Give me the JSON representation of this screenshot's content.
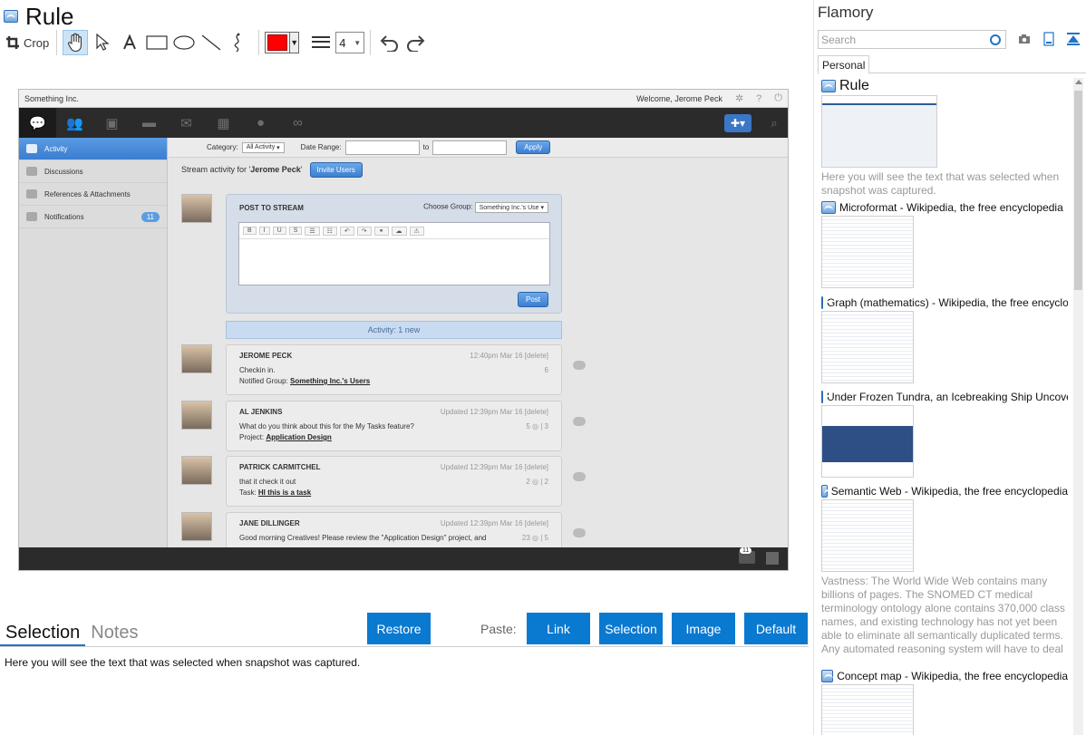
{
  "window": {
    "title": "Rule"
  },
  "toolbar": {
    "crop_label": "Crop",
    "line_width": "4",
    "color": "#ff0000",
    "tools": [
      "hand-icon",
      "pointer-icon",
      "text-icon",
      "rectangle-icon",
      "ellipse-icon",
      "line-icon",
      "freehand-icon"
    ]
  },
  "snapshot": {
    "company": "Something Inc.",
    "welcome": "Welcome, Jerome Peck",
    "sidebar": [
      {
        "label": "Activity"
      },
      {
        "label": "Discussions"
      },
      {
        "label": "References & Attachments"
      },
      {
        "label": "Notifications",
        "badge": "11"
      }
    ],
    "filter": {
      "category_label": "Category:",
      "category_value": "All Activity",
      "date_label": "Date Range:",
      "to_label": "to",
      "apply": "Apply"
    },
    "stream_prefix": "Stream activity for '",
    "stream_user": "Jerome Peck",
    "stream_suffix": "'",
    "invite": "Invite Users",
    "post": {
      "heading": "POST TO STREAM",
      "group_label": "Choose Group:",
      "group_value": "Something Inc.'s Use",
      "button": "Post",
      "tools": [
        "B",
        "I",
        "U",
        "S"
      ]
    },
    "activity_bar": "Activity: 1 new",
    "posts": [
      {
        "name": "JEROME PECK",
        "time": "12:40pm Mar 16 [delete]",
        "text": "Checkin in.",
        "meta_label": "Notified Group:",
        "meta_link": "Something Inc.'s Users",
        "counts": "6"
      },
      {
        "name": "AL JENKINS",
        "time": "Updated 12:39pm Mar 16 [delete]",
        "text": "What do you think about this for the My Tasks feature?",
        "meta_label": "Project:",
        "meta_link": "Application Design",
        "counts": "5 ◎ | 3"
      },
      {
        "name": "PATRICK CARMITCHEL",
        "time": "Updated 12:39pm Mar 16 [delete]",
        "text": "that it check it out",
        "meta_label": "Task:",
        "meta_link": "HI this is a task",
        "counts": "2 ◎ | 2"
      },
      {
        "name": "JANE DILLINGER",
        "time": "Updated 12:39pm Mar 16 [delete]",
        "text": "Good morning Creatives! Please review the \"Application Design\" project, and",
        "meta_label": "",
        "meta_link": "",
        "counts": "23 ◎ | 5"
      }
    ],
    "bottom_badge": "11"
  },
  "tabs": {
    "selection": "Selection",
    "notes": "Notes"
  },
  "buttons": {
    "restore": "Restore",
    "paste_label": "Paste:",
    "link": "Link",
    "selection": "Selection",
    "image": "Image",
    "default": "Default"
  },
  "selection_text": "Here you will see the text that was selected when snapshot was captured.",
  "panel": {
    "title": "Flamory",
    "search_placeholder": "Search",
    "tab": "Personal",
    "items": [
      {
        "title": "Rule",
        "desc": "Here you will see the text that was selected when snapshot was captured."
      },
      {
        "title": "Microformat - Wikipedia, the free encyclopedia"
      },
      {
        "title": "Graph (mathematics) - Wikipedia, the free encyclopedia"
      },
      {
        "title": "Under Frozen Tundra, an Icebreaking Ship Uncovers"
      },
      {
        "title": "Semantic Web - Wikipedia, the free encyclopedia",
        "desc": "Vastness: The World Wide Web contains many billions of pages. The SNOMED CT medical terminology ontology alone contains 370,000 class names, and existing technology has not yet been able to eliminate all semantically duplicated terms. Any automated reasoning system will have to deal with truly huge inputs."
      },
      {
        "title": "Concept map - Wikipedia, the free encyclopedia"
      }
    ]
  }
}
